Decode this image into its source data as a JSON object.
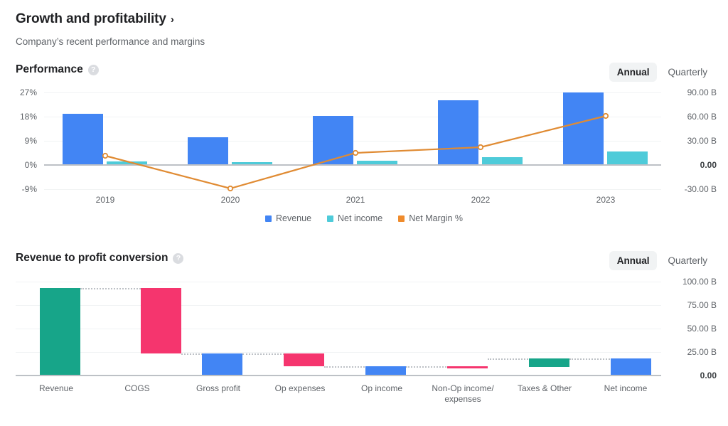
{
  "header": {
    "title": "Growth and profitability",
    "chevron": "›",
    "subtitle": "Company’s recent performance and margins"
  },
  "performance_section": {
    "label": "Performance",
    "help_icon": "?",
    "toggle": {
      "annual": "Annual",
      "quarterly": "Quarterly",
      "selected": "Annual"
    },
    "legend": [
      {
        "label": "Revenue",
        "color": "#4285f4"
      },
      {
        "label": "Net income",
        "color": "#4ecbd9"
      },
      {
        "label": "Net Margin %",
        "color": "#ef8b2c"
      }
    ]
  },
  "conversion_section": {
    "label": "Revenue to profit conversion",
    "help_icon": "?",
    "toggle": {
      "annual": "Annual",
      "quarterly": "Quarterly",
      "selected": "Annual"
    }
  },
  "colors": {
    "revenue_blue": "#4285f4",
    "net_income_teal": "#4ecbd9",
    "margin_orange": "#e08b33",
    "waterfall_positive": "#17a589",
    "waterfall_negative": "#f5356e",
    "waterfall_total": "#4285f4",
    "grid": "#f1f3f4",
    "axis": "#bdc1c6",
    "text_muted": "#5f6368"
  },
  "chart_data": [
    {
      "type": "bar",
      "id": "performance",
      "title": "Performance",
      "categories": [
        "2019",
        "2020",
        "2021",
        "2022",
        "2023"
      ],
      "series": [
        {
          "name": "Revenue",
          "type": "bar",
          "axis": "right",
          "color": "#4285f4",
          "values": [
            63.0,
            33.0,
            60.5,
            80.0,
            90.0
          ]
        },
        {
          "name": "Net income",
          "type": "bar",
          "axis": "right",
          "color": "#4ecbd9",
          "values": [
            1.5,
            0.8,
            2.0,
            4.5,
            15.5
          ]
        },
        {
          "name": "Net Margin %",
          "type": "line",
          "axis": "left",
          "color": "#e08b33",
          "values": [
            3.5,
            -9.0,
            4.5,
            6.5,
            18.0
          ]
        }
      ],
      "left_axis": {
        "label": "",
        "ticks": [
          "27%",
          "18%",
          "9%",
          "0%",
          "-9%"
        ],
        "values": [
          27,
          18,
          9,
          0,
          -9
        ]
      },
      "right_axis": {
        "label": "",
        "ticks": [
          "90.00 B",
          "60.00 B",
          "30.00 B",
          "0.00",
          "-30.00 B"
        ],
        "values": [
          90,
          60,
          30,
          0,
          -30
        ]
      },
      "grid": true,
      "legend_position": "bottom"
    },
    {
      "type": "bar",
      "id": "revenue-to-profit-conversion",
      "title": "Revenue to profit conversion",
      "subtype": "waterfall",
      "categories": [
        "Revenue",
        "COGS",
        "Gross profit",
        "Op expenses",
        "Op income",
        "Non-Op income/\nexpenses",
        "Taxes & Other",
        "Net income"
      ],
      "values": [
        94.0,
        -70.0,
        24.0,
        -12.5,
        11.5,
        1.0,
        -8.5,
        19.0
      ],
      "bar_kinds": [
        "total",
        "negative",
        "total",
        "negative",
        "total",
        "negative",
        "positive",
        "total"
      ],
      "right_axis": {
        "ticks": [
          "100.00 B",
          "75.00 B",
          "50.00 B",
          "25.00 B",
          "0.00"
        ],
        "values": [
          100,
          75,
          50,
          25,
          0
        ]
      },
      "grid": true,
      "legend_position": "none"
    }
  ]
}
